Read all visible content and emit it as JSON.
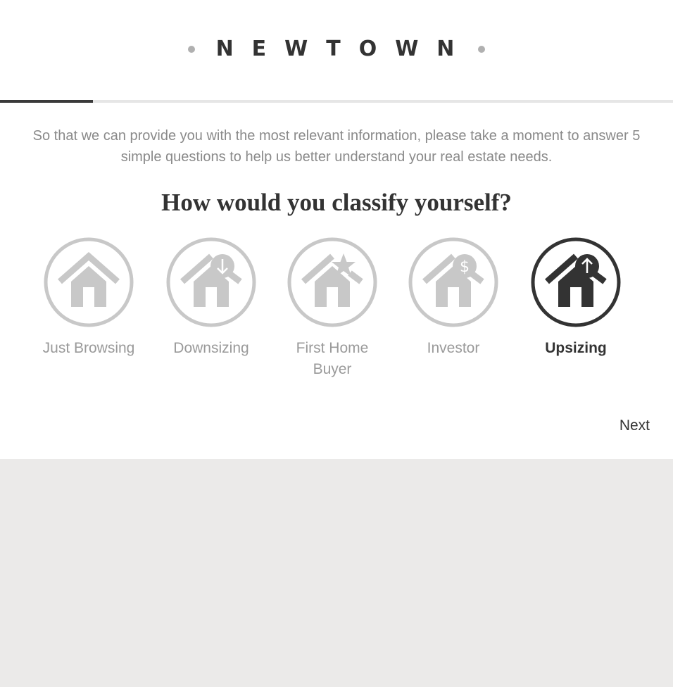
{
  "brand": {
    "logo_text": "NEWTOWN"
  },
  "progress": {
    "fraction": 0.138
  },
  "intro": {
    "text": "So that we can provide you with the most relevant information, please take a moment to answer 5 simple questions to help us better understand your real estate needs."
  },
  "question": {
    "title": "How would you classify yourself?"
  },
  "options": [
    {
      "label": "Just Browsing",
      "icon": "house-icon",
      "selected": false
    },
    {
      "label": "Downsizing",
      "icon": "house-arrow-down-icon",
      "selected": false
    },
    {
      "label": "First Home Buyer",
      "icon": "house-star-icon",
      "selected": false
    },
    {
      "label": "Investor",
      "icon": "house-dollar-icon",
      "selected": false
    },
    {
      "label": "Upsizing",
      "icon": "house-arrow-up-icon",
      "selected": true
    }
  ],
  "nav": {
    "next_label": "Next"
  },
  "colors": {
    "active": "#333333",
    "inactive": "#c8c8c8",
    "footer_bg": "#ebeae9"
  }
}
